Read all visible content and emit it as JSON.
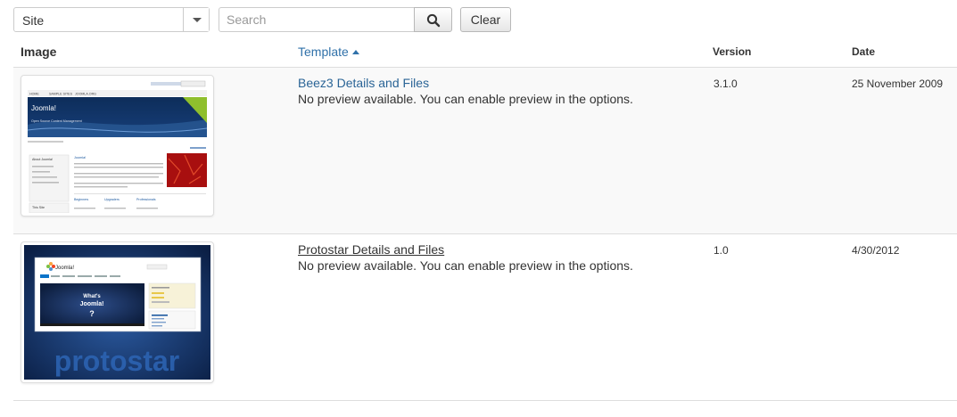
{
  "filter": {
    "client_select": "Site",
    "search_placeholder": "Search",
    "search_button_icon": "search-icon",
    "clear_label": "Clear"
  },
  "table": {
    "headers": {
      "image": "Image",
      "template": "Template",
      "version": "Version",
      "date": "Date"
    },
    "rows": [
      {
        "template_link": "Beez3 Details and Files",
        "note": "No preview available. You can enable preview in the options.",
        "version": "3.1.0",
        "date": "25 November 2009",
        "thumb": {
          "brand": "Joomla!",
          "tagline": "Open Source Content Management",
          "nav": [
            "HOME",
            "SAMPLE SITES",
            "JOOMLA.ORG"
          ],
          "heading": "Joomla!",
          "about": "About Joomla!",
          "this_site": "This Site",
          "sections": [
            "Beginners",
            "Upgraders",
            "Professionals"
          ]
        }
      },
      {
        "template_link": "Protostar Details and Files",
        "note": "No preview available. You can enable preview in the options.",
        "version": "1.0",
        "date": "4/30/2012",
        "thumb": {
          "brand": "Joomla!",
          "video_title_1": "What's",
          "video_title_2": "Joomla!",
          "wordmark": "protostar"
        }
      }
    ]
  },
  "colors": {
    "link": "#2a6496",
    "sort_header": "#3071a9",
    "row_stripe": "#f9f9f9",
    "border": "#dddddd"
  }
}
